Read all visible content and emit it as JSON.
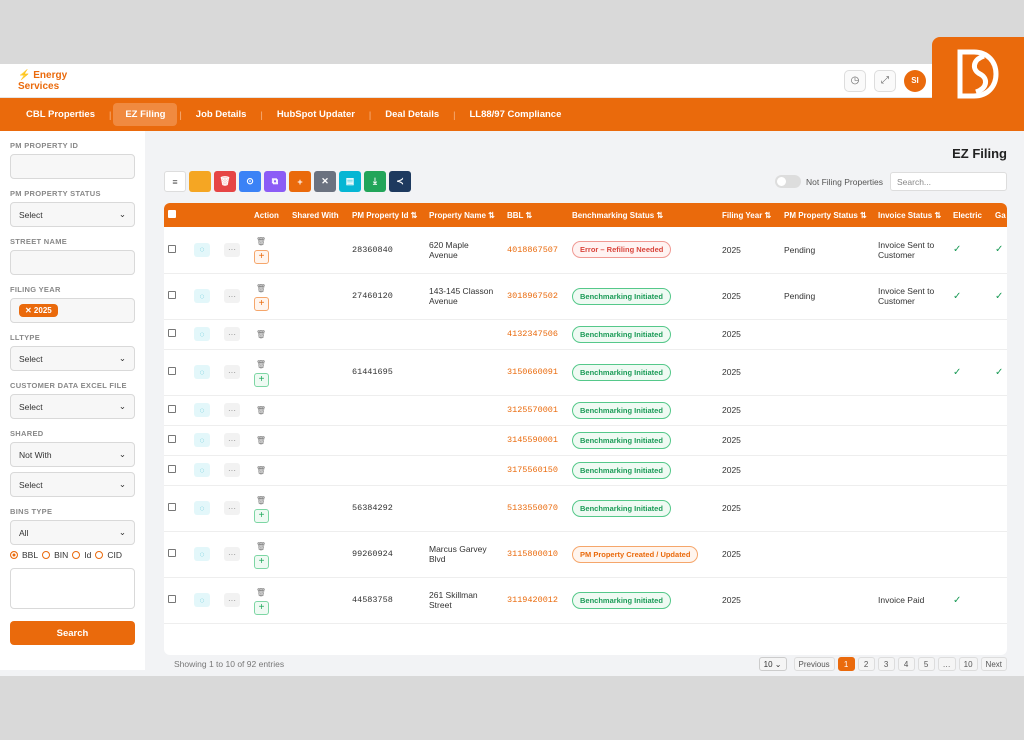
{
  "brand": {
    "icon": "⚡",
    "line1": "Energy",
    "line2": "Services"
  },
  "header": {
    "avatar": "SI"
  },
  "nav": [
    "CBL Properties",
    "EZ Filing",
    "Job Details",
    "HubSpot Updater",
    "Deal Details",
    "LL88/97 Compliance"
  ],
  "nav_active": 1,
  "sidebar": {
    "pm_property_id": "PM PROPERTY ID",
    "pm_property_status": "PM PROPERTY STATUS",
    "pm_property_status_value": "Select",
    "street_name": "STREET NAME",
    "filing_year": "FILING YEAR",
    "filing_year_chip": "✕ 2025",
    "lltype": "LLTYPE",
    "lltype_value": "Select",
    "customer_data": "CUSTOMER DATA EXCEL FILE",
    "customer_data_value": "Select",
    "shared": "SHARED",
    "shared_value": "Not With",
    "shared_value2": "Select",
    "bins_type": "BINS TYPE",
    "bins_type_value": "All",
    "radios": [
      "BBL",
      "BIN",
      "Id",
      "CID"
    ],
    "search_button": "Search"
  },
  "page_title": "EZ Filing",
  "toggle_label": "Not Filing Properties",
  "search_placeholder": "Search...",
  "columns": [
    "Action",
    "Shared With",
    "PM Property Id",
    "Property Name",
    "BBL",
    "Benchmarking Status",
    "Filing Year",
    "PM Property Status",
    "Invoice Status",
    "Electric",
    "Ga"
  ],
  "rows": [
    {
      "pm_id": "28360840",
      "name": "620 Maple Avenue",
      "bbl": "4018867507",
      "status": "Error – Refiling Needed",
      "status_type": "red",
      "year": "2025",
      "pm_status": "Pending",
      "invoice": "Invoice Sent to Customer",
      "electric": "✓",
      "gas": "✓",
      "plus": "o"
    },
    {
      "pm_id": "27460120",
      "name": "143-145 Classon Avenue",
      "bbl": "3018967502",
      "status": "Benchmarking Initiated",
      "status_type": "green",
      "year": "2025",
      "pm_status": "Pending",
      "invoice": "Invoice Sent to Customer",
      "electric": "✓",
      "gas": "✓",
      "plus": "o"
    },
    {
      "pm_id": "",
      "name": "",
      "bbl": "4132347506",
      "status": "Benchmarking Initiated",
      "status_type": "green",
      "year": "2025",
      "pm_status": "",
      "invoice": "",
      "electric": "",
      "gas": "",
      "plus": ""
    },
    {
      "pm_id": "61441695",
      "name": "",
      "bbl": "3150660091",
      "status": "Benchmarking Initiated",
      "status_type": "green",
      "year": "2025",
      "pm_status": "",
      "invoice": "",
      "electric": "✓",
      "gas": "✓",
      "plus": "g"
    },
    {
      "pm_id": "",
      "name": "",
      "bbl": "3125570001",
      "status": "Benchmarking Initiated",
      "status_type": "green",
      "year": "2025",
      "pm_status": "",
      "invoice": "",
      "electric": "",
      "gas": "",
      "plus": ""
    },
    {
      "pm_id": "",
      "name": "",
      "bbl": "3145590001",
      "status": "Benchmarking Initiated",
      "status_type": "green",
      "year": "2025",
      "pm_status": "",
      "invoice": "",
      "electric": "",
      "gas": "",
      "plus": ""
    },
    {
      "pm_id": "",
      "name": "",
      "bbl": "3175560150",
      "status": "Benchmarking Initiated",
      "status_type": "green",
      "year": "2025",
      "pm_status": "",
      "invoice": "",
      "electric": "",
      "gas": "",
      "plus": ""
    },
    {
      "pm_id": "56384292",
      "name": "",
      "bbl": "5133550070",
      "status": "Benchmarking Initiated",
      "status_type": "green",
      "year": "2025",
      "pm_status": "",
      "invoice": "",
      "electric": "",
      "gas": "",
      "plus": "g"
    },
    {
      "pm_id": "99260924",
      "name": "Marcus Garvey Blvd",
      "bbl": "3115800010",
      "status": "PM Property Created / Updated",
      "status_type": "orange",
      "year": "2025",
      "pm_status": "",
      "invoice": "",
      "electric": "",
      "gas": "",
      "plus": "g"
    },
    {
      "pm_id": "44583758",
      "name": "261 Skillman Street",
      "bbl": "3119420012",
      "status": "Benchmarking Initiated",
      "status_type": "green",
      "year": "2025",
      "pm_status": "",
      "invoice": "Invoice Paid",
      "electric": "✓",
      "gas": "",
      "plus": "g"
    }
  ],
  "footer": {
    "info": "Showing 1 to 10 of 92 entries",
    "page_size": "10",
    "prev": "Previous",
    "pages": [
      "1",
      "2",
      "3",
      "4",
      "5",
      "…",
      "10"
    ],
    "next": "Next"
  },
  "toolbar_colors": [
    "#ffffff",
    "#f5a623",
    "#e64545",
    "#3b82f6",
    "#8b5cf6",
    "#ea6a0c",
    "#6b7280",
    "#06b6d4",
    "#22a55a",
    "#1e3a5f"
  ]
}
